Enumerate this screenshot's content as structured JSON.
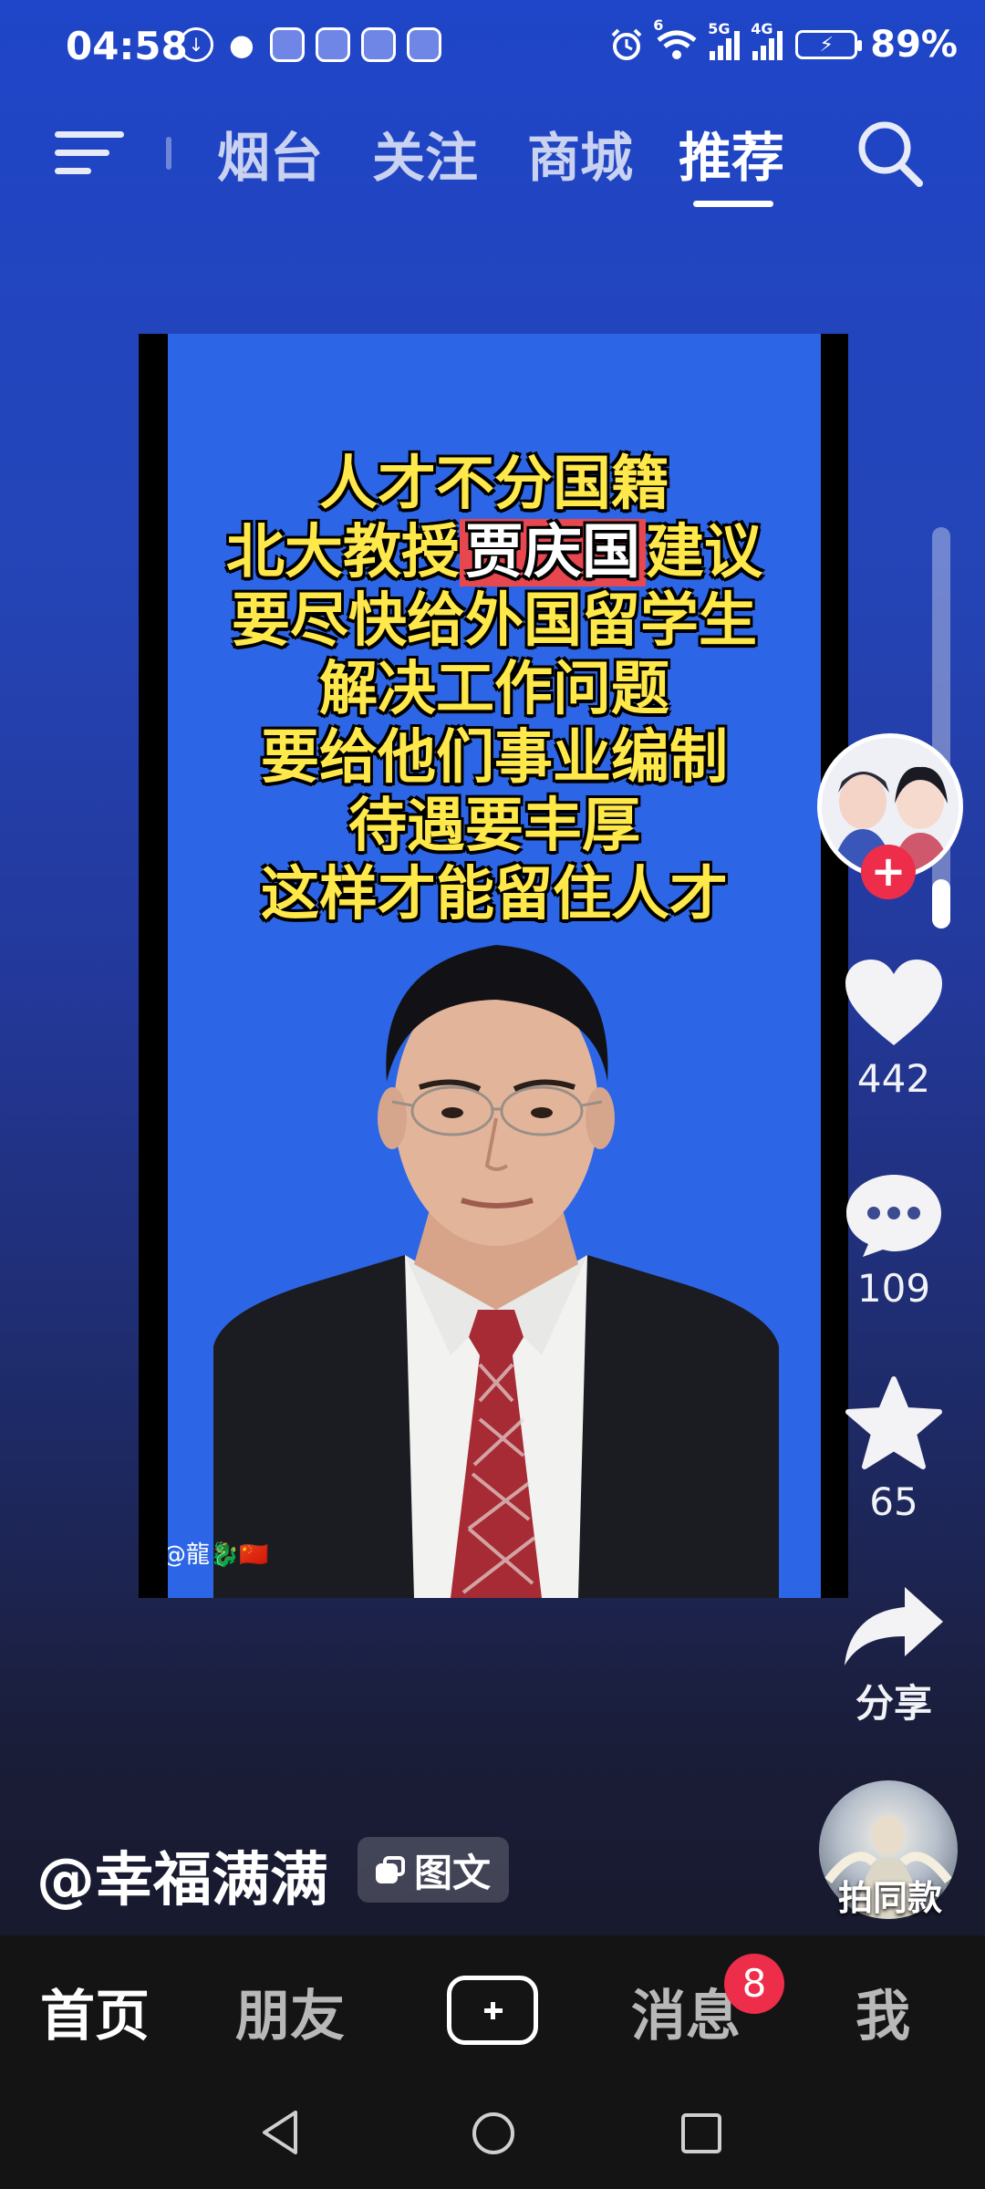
{
  "status_bar": {
    "time": "04:58",
    "signal_6": "6",
    "signal_5g": "5G",
    "signal_4g": "4G",
    "battery": "89%"
  },
  "top_nav": {
    "tabs": [
      {
        "label": "烟台",
        "active": false
      },
      {
        "label": "关注",
        "active": false
      },
      {
        "label": "商城",
        "active": false
      },
      {
        "label": "推荐",
        "active": true
      }
    ]
  },
  "video": {
    "caption_lines": [
      "人才不分国籍",
      "北大教授",
      "贾庆国",
      "建议",
      "要尽快给外国留学生",
      "解决工作问题",
      "要给他们事业编制",
      "待遇要丰厚",
      "这样才能留住人才"
    ],
    "watermark": "@龍🐉🇨🇳"
  },
  "right_rail": {
    "likes": "442",
    "comments": "109",
    "favorites": "65",
    "share_label": "分享",
    "remix_label": "拍同款"
  },
  "post": {
    "author": "@幸福满满",
    "type_label": "图文"
  },
  "bottom_nav": {
    "items": [
      "首页",
      "朋友",
      "消息",
      "我"
    ],
    "messages_badge": "8"
  },
  "colors": {
    "accent_red": "#ee2d4a",
    "caption_yellow": "#ffe94a",
    "video_blue": "#2c66e6"
  }
}
